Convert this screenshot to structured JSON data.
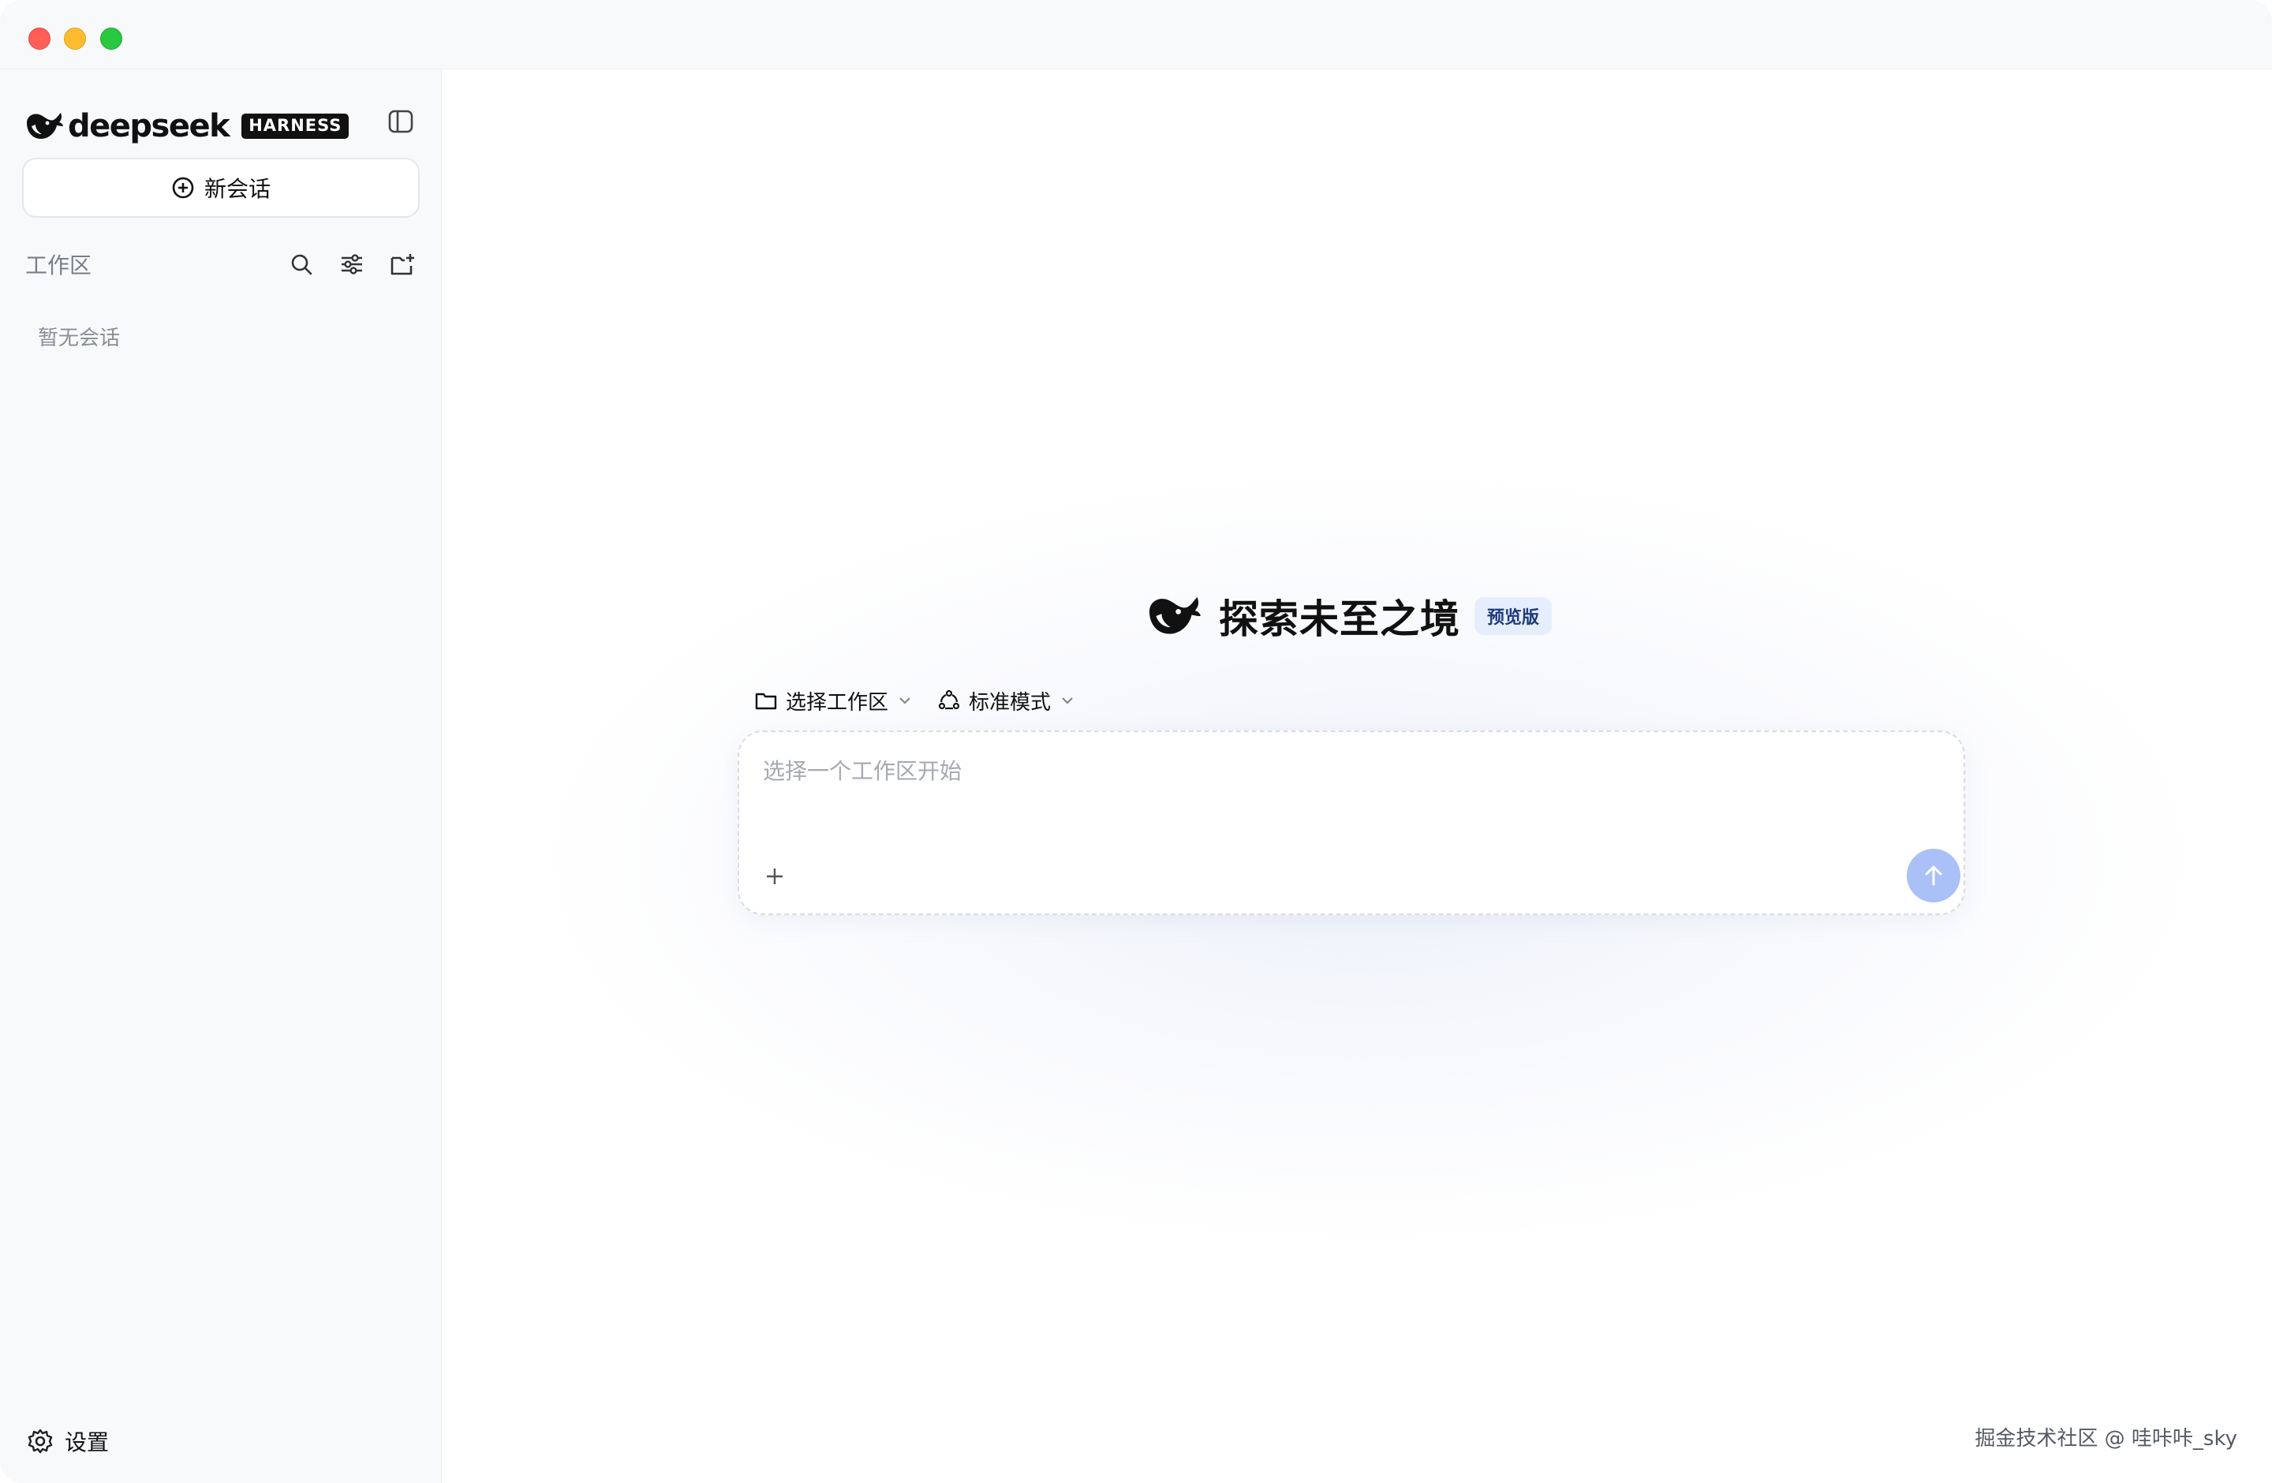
{
  "window": {
    "controls": [
      "close",
      "minimize",
      "maximize"
    ],
    "colors": {
      "close": "#ff5f57",
      "minimize": "#febc2e",
      "maximize": "#28c840"
    }
  },
  "sidebar": {
    "brand_name": "deepseek",
    "brand_tag": "HARNESS",
    "toggle_icon": "sidebar-toggle-icon",
    "new_chat_label": "新会话",
    "new_chat_icon": "plus-circle-icon",
    "workspace_label": "工作区",
    "workspace_tools": [
      "search-icon",
      "filter-sliders-icon",
      "new-folder-icon"
    ],
    "empty_text": "暂无会话",
    "settings_label": "设置",
    "settings_icon": "gear-icon"
  },
  "main": {
    "hero_title": "探索未至之境",
    "hero_badge": "预览版",
    "workspace_selector_label": "选择工作区",
    "mode_selector_label": "标准模式",
    "input_placeholder": "选择一个工作区开始",
    "attach_icon": "plus-icon",
    "send_icon": "arrow-up-icon",
    "send_color": "#a9c1f7",
    "accent_badge_bg": "#e6eefe"
  },
  "watermark": "掘金技术社区 @ 哇咔咔_sky"
}
